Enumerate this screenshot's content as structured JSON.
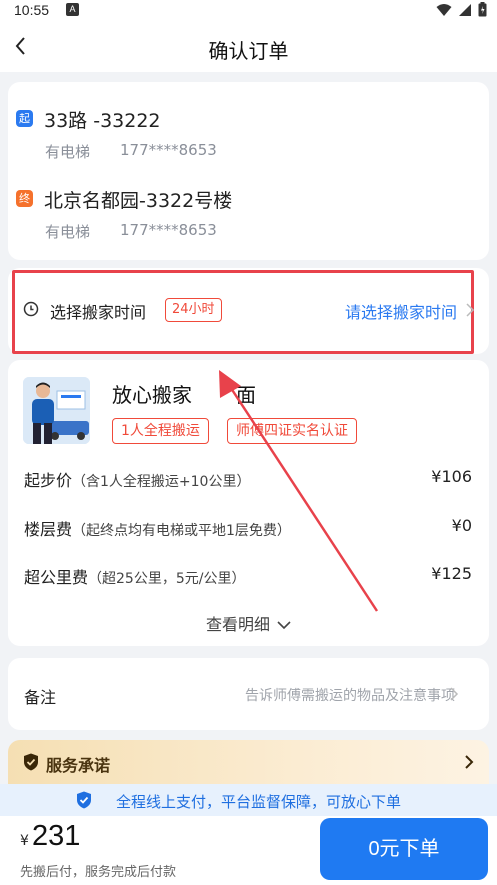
{
  "status_bar": {
    "time": "10:55",
    "notification_letter": "A"
  },
  "nav": {
    "title": "确认订单"
  },
  "addresses": {
    "start": {
      "badge": "起",
      "title": "33路 -33222",
      "elevator": "有电梯",
      "phone": "177****8653"
    },
    "end": {
      "badge": "终",
      "title": "北京名都园-3322号楼",
      "elevator": "有电梯",
      "phone": "177****8653"
    }
  },
  "moving_time": {
    "label": "选择搬家时间",
    "tag": "24小时",
    "placeholder": "请选择搬家时间"
  },
  "service": {
    "name": "放心搬家",
    "name_suffix": "面",
    "tags": [
      "1人全程搬运",
      "师傅四证实名认证"
    ],
    "prices": [
      {
        "label": "起步价",
        "note": "（含1人全程搬运+10公里）",
        "value": "¥106"
      },
      {
        "label": "楼层费",
        "note": "（起终点均有电梯或平地1层免费）",
        "value": "¥0"
      },
      {
        "label": "超公里费",
        "note": "（超25公里，5元/公里）",
        "value": "¥125"
      }
    ],
    "detail_link": "查看明细"
  },
  "remark": {
    "label": "备注",
    "placeholder": "告诉师傅需搬运的物品及注意事项"
  },
  "promise": {
    "title": "服务承诺",
    "guarantee": "全程线上支付，平台监督保障，可放心下单"
  },
  "footer": {
    "currency": "¥",
    "total": "231",
    "note": "先搬后付，服务完成后付款",
    "order_button": "0元下单"
  },
  "colors": {
    "accent": "#1f7af2",
    "warning_red": "#f04a3a",
    "highlight_box": "#e8424b",
    "start_badge": "#2b7af0",
    "end_badge": "#f5712c"
  }
}
